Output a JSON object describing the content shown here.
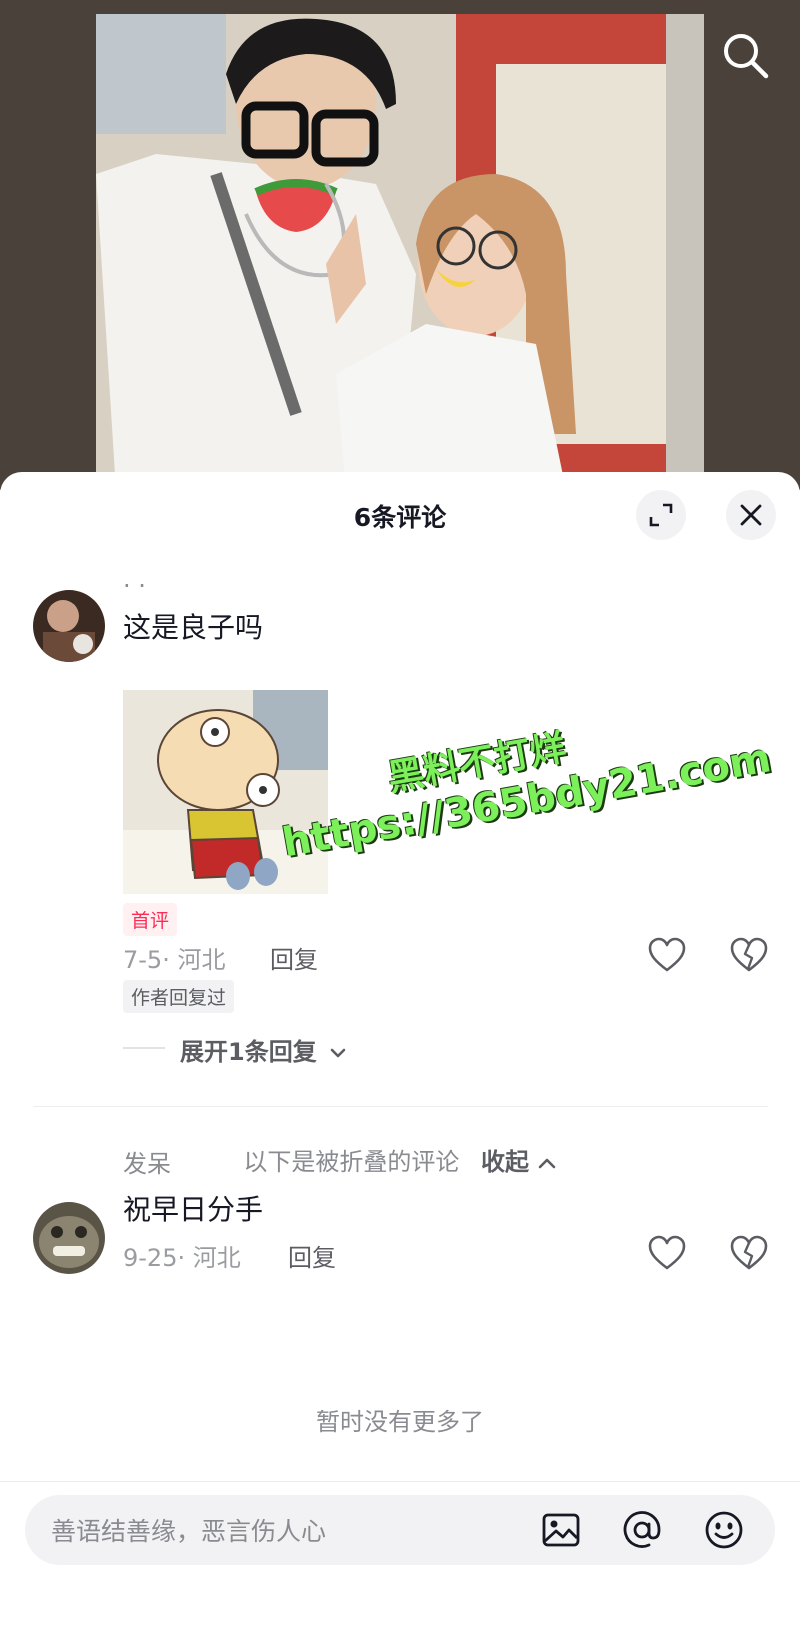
{
  "header": {
    "search_icon": "search-icon"
  },
  "sheet": {
    "title": "6条评论",
    "expand_icon": "expand-icon",
    "close_icon": "close-icon"
  },
  "comments": [
    {
      "username": "· ·",
      "text": "这是良子吗",
      "sticker": "cartoon-baby-sticker",
      "tag_first": "首评",
      "date_location": "7-5· 河北",
      "reply_label": "回复",
      "tag_author": "作者回复过",
      "expand_replies": "展开1条回复"
    },
    {
      "username": "发呆",
      "text": "祝早日分手",
      "date_location": "9-25· 河北",
      "reply_label": "回复"
    }
  ],
  "folded_notice": "以下是被折叠的评论",
  "collapse_label": "收起",
  "no_more": "暂时没有更多了",
  "input": {
    "placeholder": "善语结善缘，恶言伤人心",
    "icons": [
      "image-icon",
      "at-icon",
      "emoji-icon"
    ]
  },
  "watermark": {
    "line1": "黑料不打烊",
    "line2": "https://365bdy21.com"
  },
  "colors": {
    "accent": "#fe2c55",
    "watermark": "#7cf05a"
  }
}
